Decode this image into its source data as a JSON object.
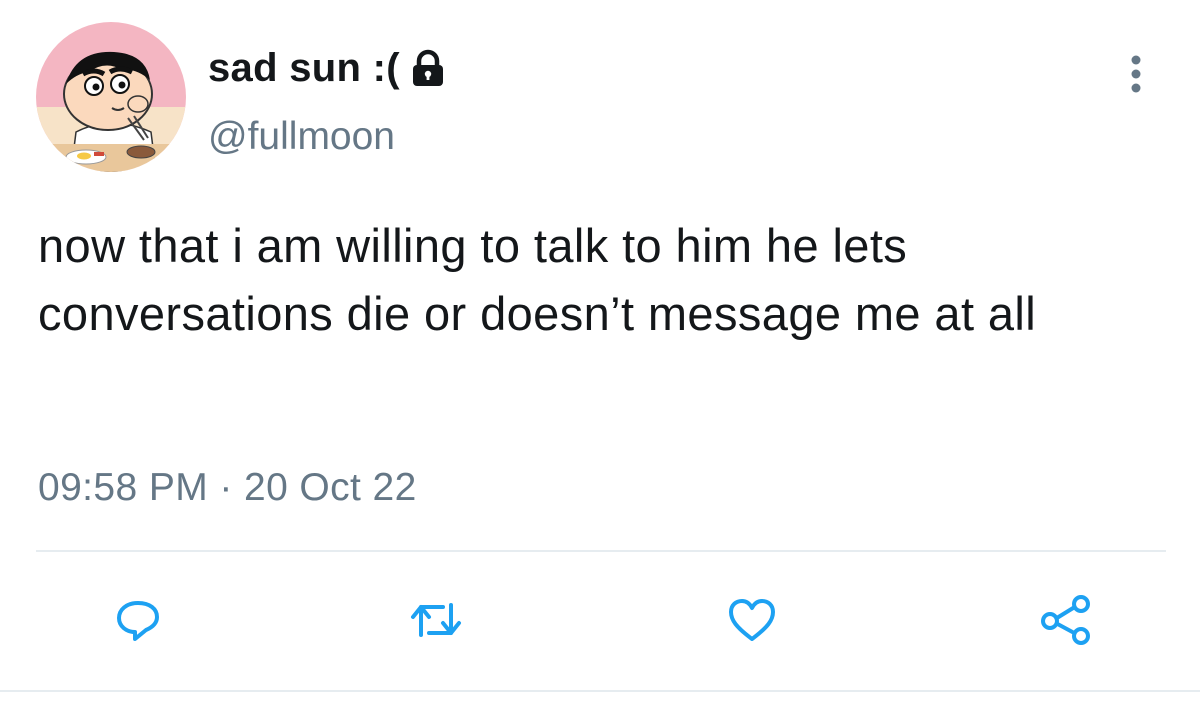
{
  "tweet": {
    "display_name": "sad sun :(",
    "handle": "@fullmoon",
    "text": "now that i am willing to talk to him he lets conversations die or doesn’t message me at all",
    "time": "09:58 PM",
    "separator": " · ",
    "date": "20 Oct 22",
    "protected_icon": "lock-icon",
    "avatar_icon": "cartoon-avatar",
    "more_icon": "vertical-ellipsis-icon"
  },
  "actions": [
    {
      "name": "reply",
      "icon": "speech-bubble-icon"
    },
    {
      "name": "retweet",
      "icon": "retweet-arrows-icon"
    },
    {
      "name": "like",
      "icon": "heart-icon"
    },
    {
      "name": "share",
      "icon": "share-nodes-icon"
    }
  ],
  "colors": {
    "text_primary": "#14171a",
    "text_secondary": "#657786",
    "icon_accent": "#1da1f2",
    "divider": "#e6ecf0"
  }
}
